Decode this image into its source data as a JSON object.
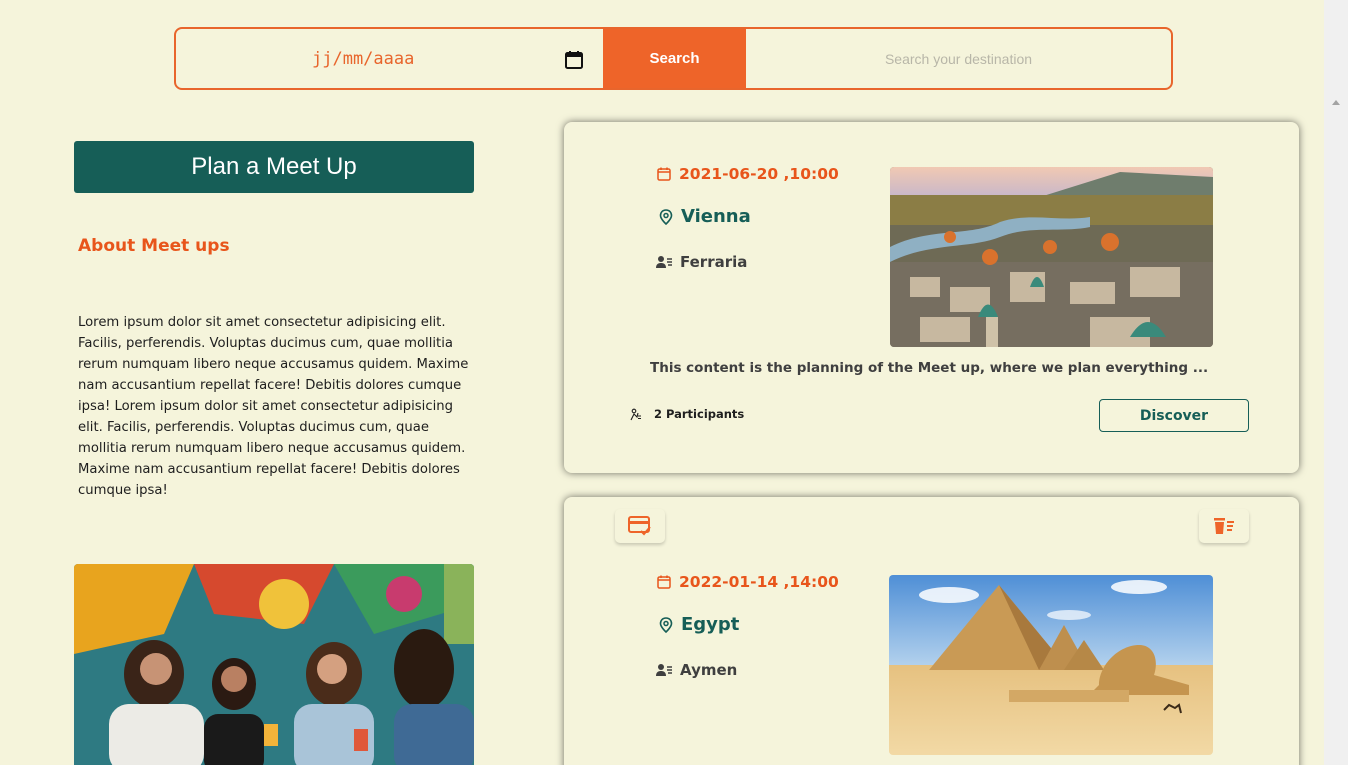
{
  "search": {
    "date_placeholder": "jj/mm/aaaa",
    "button_label": "Search",
    "destination_placeholder": "Search your destination"
  },
  "sidebar": {
    "plan_button": "Plan a Meet Up",
    "about_title": "About Meet ups",
    "about_text": "Lorem ipsum dolor sit amet consectetur adipisicing elit. Facilis, perferendis. Voluptas ducimus cum, quae mollitia rerum numquam libero neque accusamus quidem. Maxime nam accusantium repellat facere! Debitis dolores cumque ipsa! Lorem ipsum dolor sit amet consectetur adipisicing elit. Facilis, perferendis. Voluptas ducimus cum, quae mollitia rerum numquam libero neque accusamus quidem. Maxime nam accusantium repellat facere! Debitis dolores cumque ipsa!"
  },
  "meetups": [
    {
      "date": "2021-06-20 ,10:00",
      "city": "Vienna",
      "host": "Ferraria",
      "description": "This content is the planning of the Meet up, where we plan everything ...",
      "participants": "2 Participants",
      "discover_label": "Discover"
    },
    {
      "date": "2022-01-14 ,14:00",
      "city": "Egypt",
      "host": "Aymen"
    }
  ],
  "colors": {
    "background": "#f5f4db",
    "accent_orange": "#ee6429",
    "accent_green": "#165e57"
  },
  "icons": [
    "calendar-icon",
    "location-pin-icon",
    "user-list-icon",
    "participants-icon",
    "card-check-icon",
    "trash-list-icon"
  ]
}
